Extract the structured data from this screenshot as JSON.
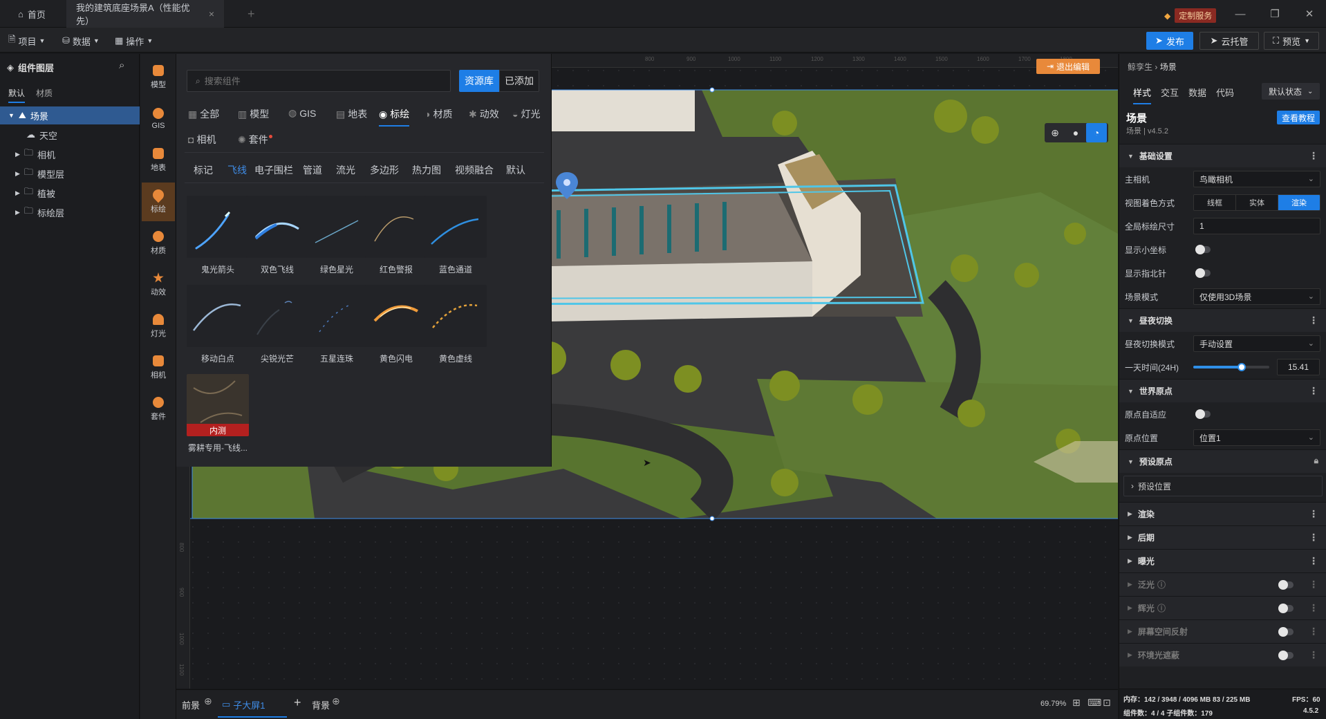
{
  "titlebar": {
    "home_label": "首页",
    "active_tab": "我的建筑底座场景A（性能优先）",
    "service_label": "定制服务"
  },
  "toolbar": {
    "project": "项目",
    "data": "数据",
    "operate": "操作",
    "publish": "发布",
    "cloud": "云托管",
    "preview": "预览"
  },
  "layers": {
    "title": "组件图层",
    "tabs": [
      "默认",
      "材质"
    ],
    "items": [
      "场景",
      "天空",
      "相机",
      "模型层",
      "植被",
      "标绘层"
    ]
  },
  "iconcol": {
    "items": [
      "模型",
      "GIS",
      "地表",
      "标绘",
      "材质",
      "动效",
      "灯光",
      "相机",
      "套件"
    ]
  },
  "library": {
    "search_placeholder": "搜索组件",
    "btn_library": "资源库",
    "btn_added": "已添加",
    "categories": [
      "全部",
      "模型",
      "GIS",
      "地表",
      "标绘",
      "材质",
      "动效",
      "灯光",
      "相机",
      "套件"
    ],
    "subtabs": [
      "标记",
      "飞线",
      "电子围栏",
      "管道",
      "流光",
      "多边形",
      "热力图",
      "视频融合",
      "默认"
    ],
    "assets": [
      "鬼光箭头",
      "双色飞线",
      "绿色星光",
      "红色警报",
      "蓝色通道",
      "移动白点",
      "尖锐光芒",
      "五星连珠",
      "黄色闪电",
      "黄色虚线"
    ],
    "special_asset": {
      "badge": "内测",
      "label": "雾耕专用-飞线..."
    }
  },
  "viewport": {
    "exit_edit": "退出编辑",
    "ruler_top": [
      "800",
      "900",
      "1000",
      "1100",
      "1200",
      "1300",
      "1400",
      "1500",
      "1600",
      "1700",
      "1800"
    ],
    "ruler_left": [
      "800",
      "900",
      "1000",
      "1100"
    ]
  },
  "bottombar": {
    "front": "前景",
    "sub_screen": "子大屏1",
    "back": "背景",
    "zoom": "69.79%"
  },
  "props": {
    "breadcrumb_root": "鲸孪生",
    "breadcrumb_leaf": "场景",
    "tabs": [
      "样式",
      "交互",
      "数据",
      "代码"
    ],
    "state": "默认状态",
    "scene_title": "场景",
    "scene_version": "场景 | v4.5.2",
    "tutorial": "查看教程",
    "sections": {
      "basic": "基础设置",
      "daynight": "昼夜切换",
      "origin": "世界原点",
      "preset": "预设原点",
      "render": "渲染",
      "post": "后期",
      "exposure": "曝光",
      "bloom": "泛光",
      "glow": "辉光",
      "ssr": "屏幕空间反射",
      "ao": "环境光遮蔽"
    },
    "camera_label": "主相机",
    "camera_value": "鸟瞰相机",
    "shading_label": "视图着色方式",
    "shading_options": [
      "线框",
      "实体",
      "渲染"
    ],
    "plot_size_label": "全局标绘尺寸",
    "plot_size_value": "1",
    "show_axes": "显示小坐标",
    "show_compass": "显示指北针",
    "scene_mode_label": "场景模式",
    "scene_mode_value": "仅使用3D场景",
    "daynight_mode_label": "昼夜切换模式",
    "daynight_mode_value": "手动设置",
    "time_label": "一天时间(24H)",
    "time_value": "15.41",
    "time_fraction": 0.64,
    "origin_auto": "原点自适应",
    "origin_pos_label": "原点位置",
    "origin_pos_value": "位置1",
    "preset_pos": "预设位置"
  },
  "status": {
    "memory": "内存：142 / 3948 / 4096 MB  83 / 225 MB",
    "fps": "FPS：60",
    "components": "组件数：4 / 4   子组件数：179",
    "version": "4.5.2"
  },
  "colors": {
    "accent": "#1e7ee6",
    "orange": "#e8893a",
    "grass": "#5f7a34",
    "road": "#3b3b3d"
  }
}
